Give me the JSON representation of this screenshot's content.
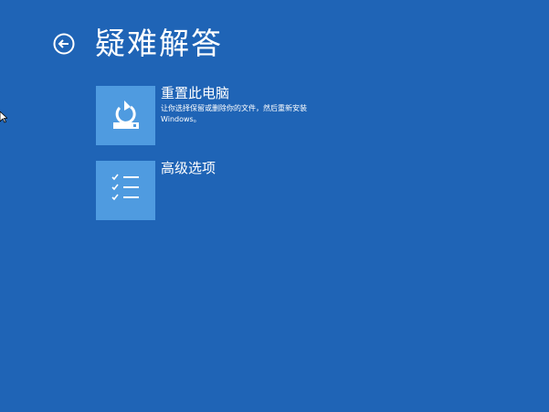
{
  "header": {
    "title": "疑难解答",
    "back_icon": "back-arrow-circle-icon"
  },
  "options": [
    {
      "title": "重置此电脑",
      "description": "让你选择保留或删除你的文件，然后重新安装 Windows。",
      "icon": "reset-pc-icon"
    },
    {
      "title": "高级选项",
      "description": "",
      "icon": "checklist-icon"
    }
  ],
  "colors": {
    "background": "#1f64b6",
    "tile": "#4f9be0",
    "text": "#ffffff"
  }
}
